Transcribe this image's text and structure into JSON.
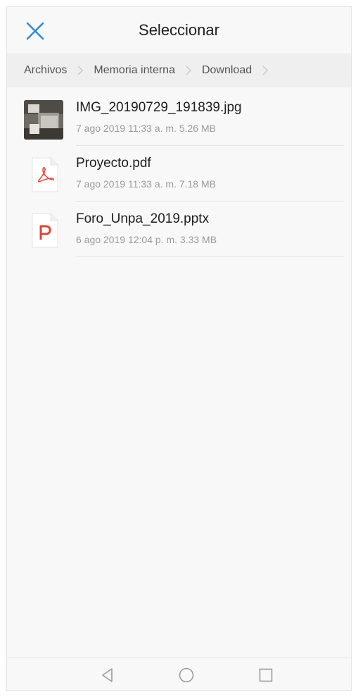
{
  "header": {
    "title": "Seleccionar",
    "close_icon": "close-icon",
    "accent": "#2f8bd8"
  },
  "breadcrumb": [
    "Archivos",
    "Memoria interna",
    "Download"
  ],
  "files": [
    {
      "name": "IMG_20190729_191839.jpg",
      "meta": "7 ago 2019 11:33 a. m. 5.26 MB",
      "icon": "image-thumbnail"
    },
    {
      "name": "Proyecto.pdf",
      "meta": "7 ago 2019 11:33 a. m. 7.18 MB",
      "icon": "pdf-file-icon"
    },
    {
      "name": "Foro_Unpa_2019.pptx",
      "meta": "6 ago 2019 12:04 p. m. 3.33 MB",
      "icon": "pptx-file-icon"
    }
  ],
  "navbar": {
    "back": "back-icon",
    "home": "home-icon",
    "recents": "recents-icon"
  },
  "colors": {
    "pdf_red": "#e24a3b",
    "pptx_red": "#d9453b"
  }
}
